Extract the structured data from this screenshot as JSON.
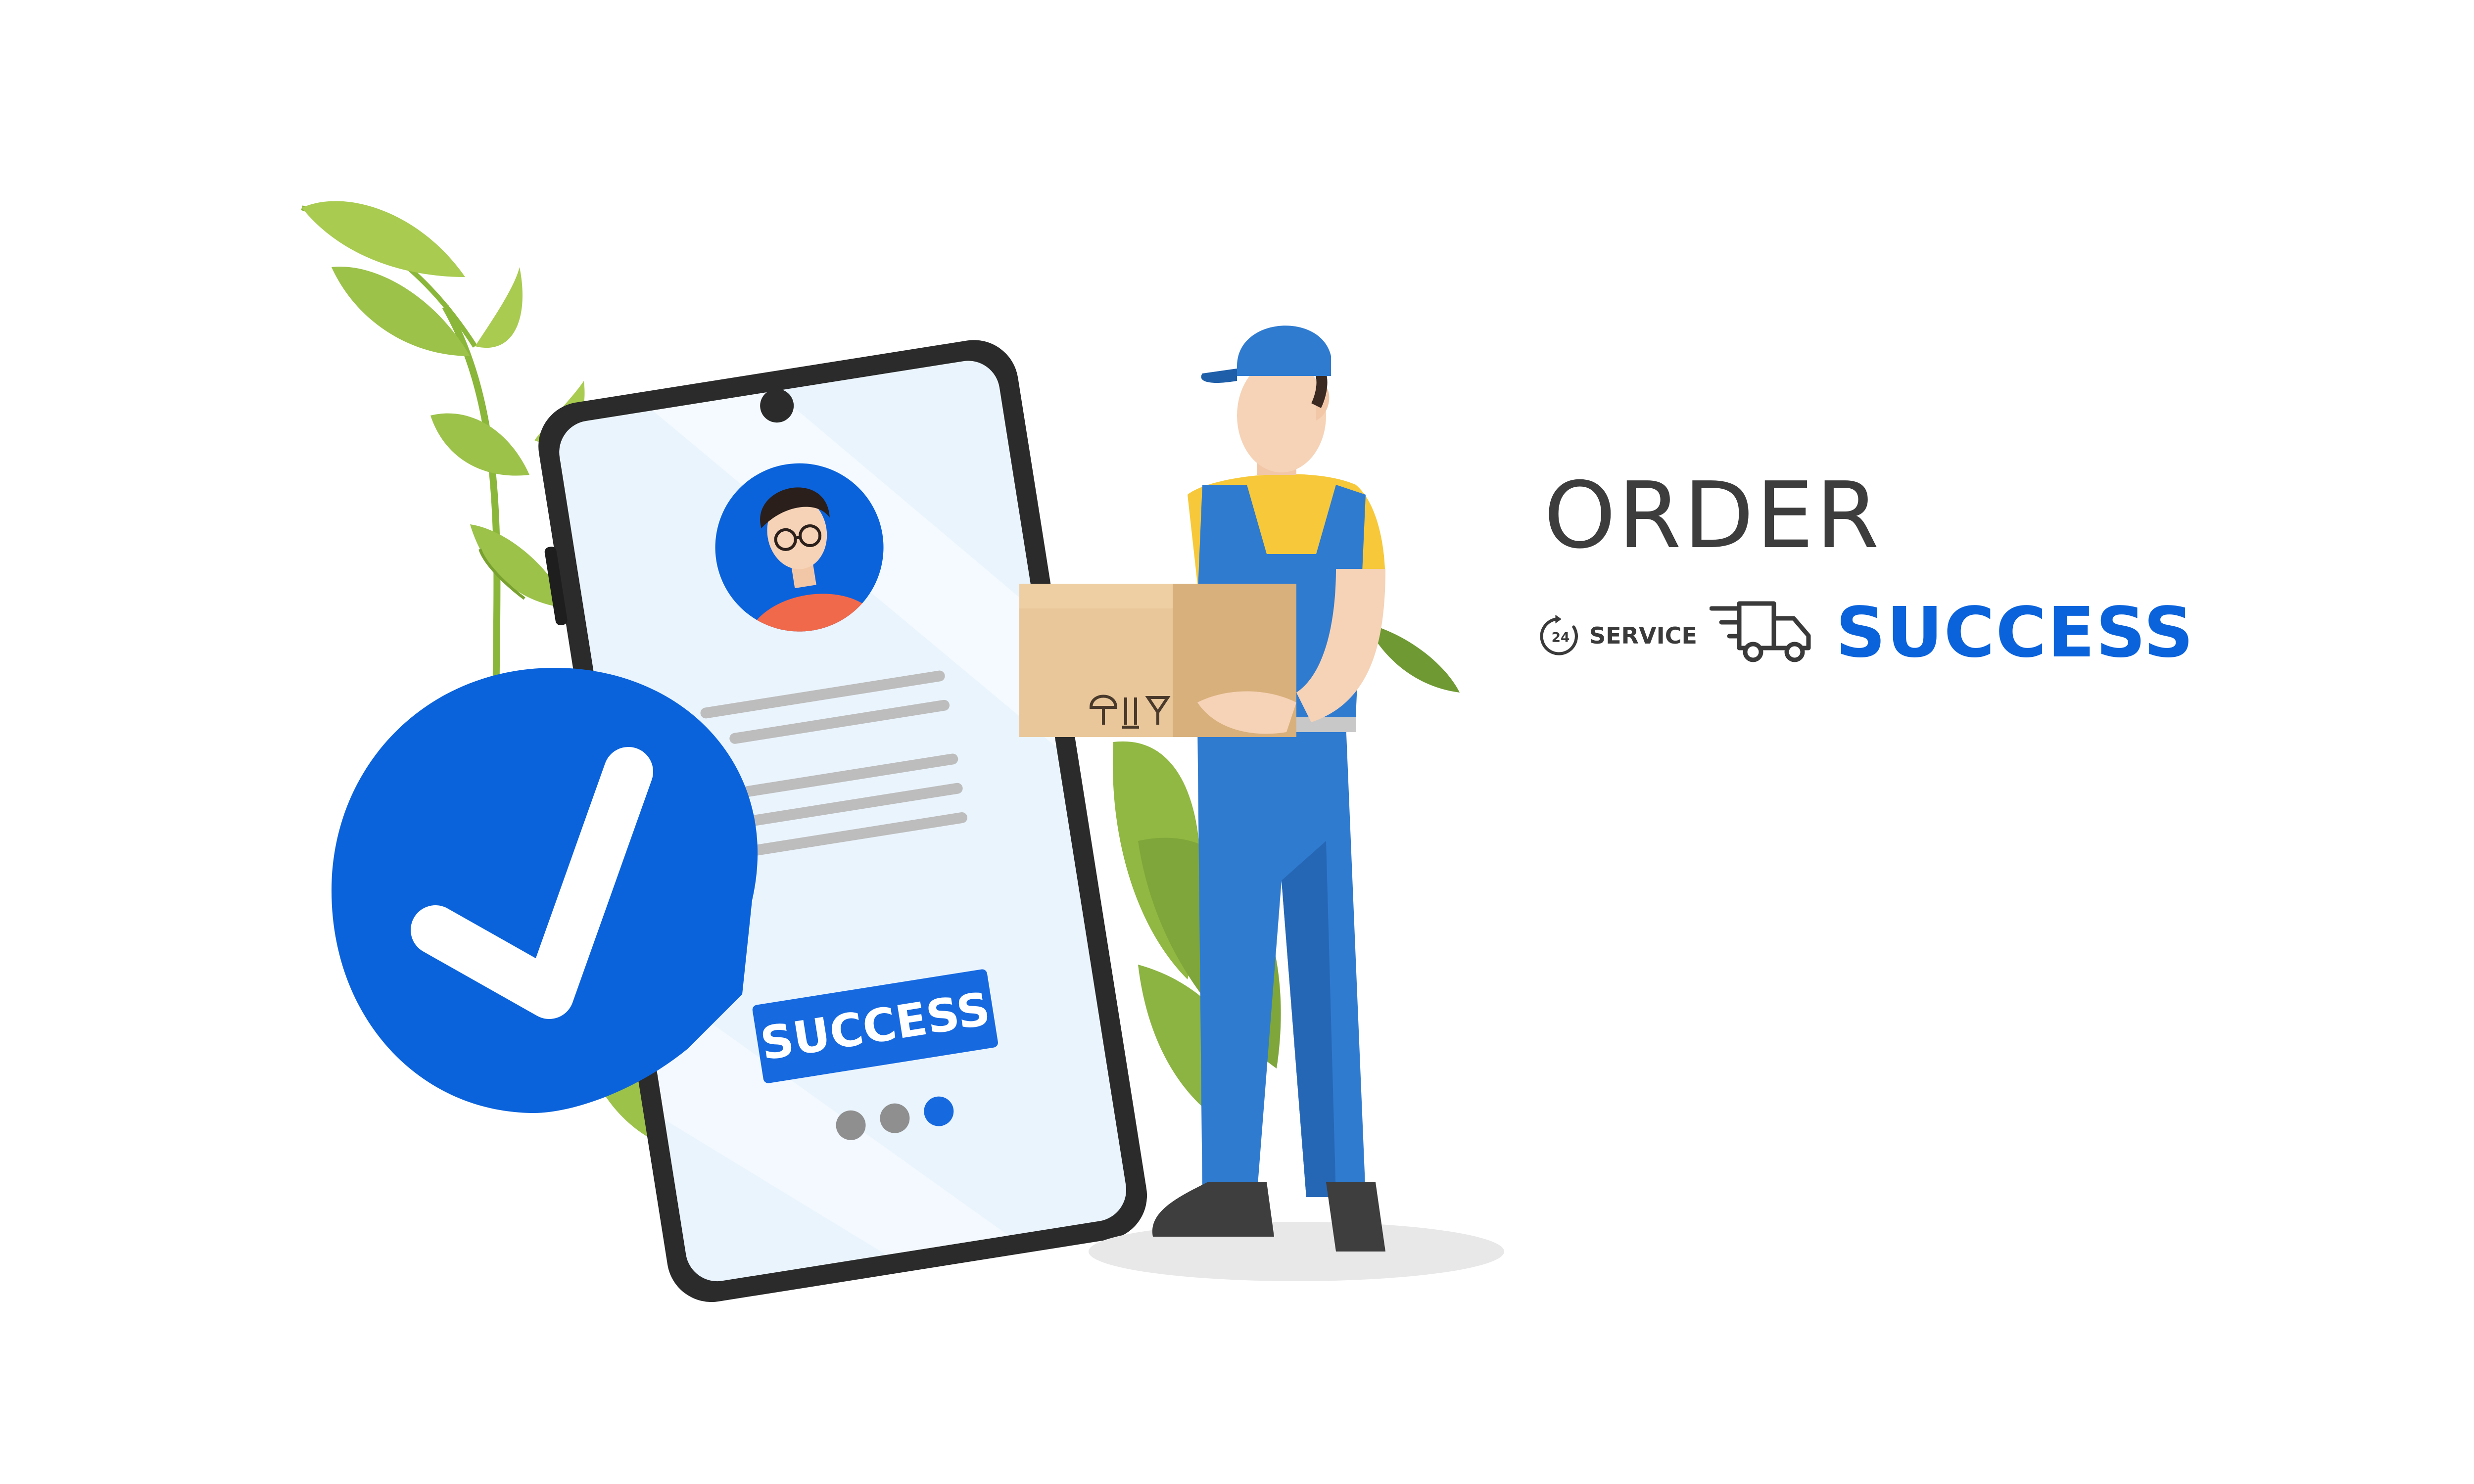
{
  "headline": {
    "title": "ORDER",
    "service_number": "24",
    "service_label": "SERVICE",
    "status": "SUCCESS"
  },
  "phone": {
    "button_label": "SUCCESS",
    "pager_total": 3,
    "pager_active": 3
  },
  "icons": {
    "check": "check-icon",
    "clock": "clock-24-icon",
    "truck": "delivery-truck-icon",
    "avatar": "user-avatar"
  },
  "colors": {
    "brand_blue": "#0b63dc",
    "heading_gray": "#3d3d3d",
    "leaf_green": "#9cc24a",
    "box_tan": "#e9c79a",
    "overall_blue": "#2f7bd0",
    "shirt_yellow": "#f6c83a"
  }
}
